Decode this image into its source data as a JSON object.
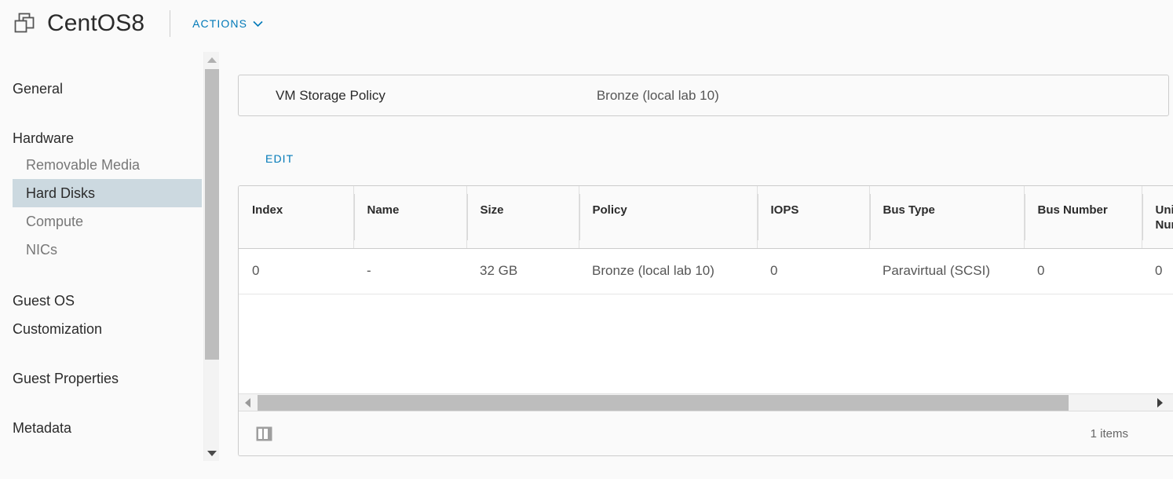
{
  "header": {
    "vm_icon": "virtual-machine-icon",
    "title": "CentOS8",
    "actions_label": "ACTIONS",
    "actions_caret": "chevron-down-icon"
  },
  "sidebar": {
    "items": [
      {
        "label": "General",
        "type": "top",
        "selected": false
      },
      {
        "label": "Hardware",
        "type": "top",
        "selected": false
      },
      {
        "label": "Removable Media",
        "type": "sub",
        "selected": false
      },
      {
        "label": "Hard Disks",
        "type": "sub",
        "selected": true
      },
      {
        "label": "Compute",
        "type": "sub",
        "selected": false
      },
      {
        "label": "NICs",
        "type": "sub",
        "selected": false
      },
      {
        "label": "Guest OS",
        "type": "top",
        "selected": false
      },
      {
        "label": "Customization",
        "type": "top",
        "selected": false
      },
      {
        "label": "Guest Properties",
        "type": "top",
        "selected": false
      },
      {
        "label": "Metadata",
        "type": "top",
        "selected": false
      }
    ],
    "scrollbar": {
      "up_icon": "scroll-up-arrow-icon",
      "down_icon": "scroll-down-arrow-icon"
    }
  },
  "main": {
    "storage_policy": {
      "label": "VM Storage Policy",
      "value": "Bronze (local lab 10)"
    },
    "edit_label": "EDIT",
    "table": {
      "columns": [
        "Index",
        "Name",
        "Size",
        "Policy",
        "IOPS",
        "Bus Type",
        "Bus Number",
        "Unit Number"
      ],
      "rows": [
        {
          "Index": "0",
          "Name": "-",
          "Size": "32 GB",
          "Policy": "Bronze (local lab 10)",
          "IOPS": "0",
          "Bus Type": "Paravirtual (SCSI)",
          "Bus Number": "0",
          "Unit Number": "0"
        }
      ],
      "footer": {
        "columns_icon": "column-picker-icon",
        "items_count": "1 items"
      },
      "hscrollbar": {
        "left_icon": "scroll-left-arrow-icon",
        "right_icon": "scroll-right-arrow-icon"
      }
    }
  },
  "colors": {
    "accent": "#0079b8",
    "selected_nav_bg": "#ccd9e0",
    "page_bg": "#fafafa",
    "border": "#cccccc"
  }
}
